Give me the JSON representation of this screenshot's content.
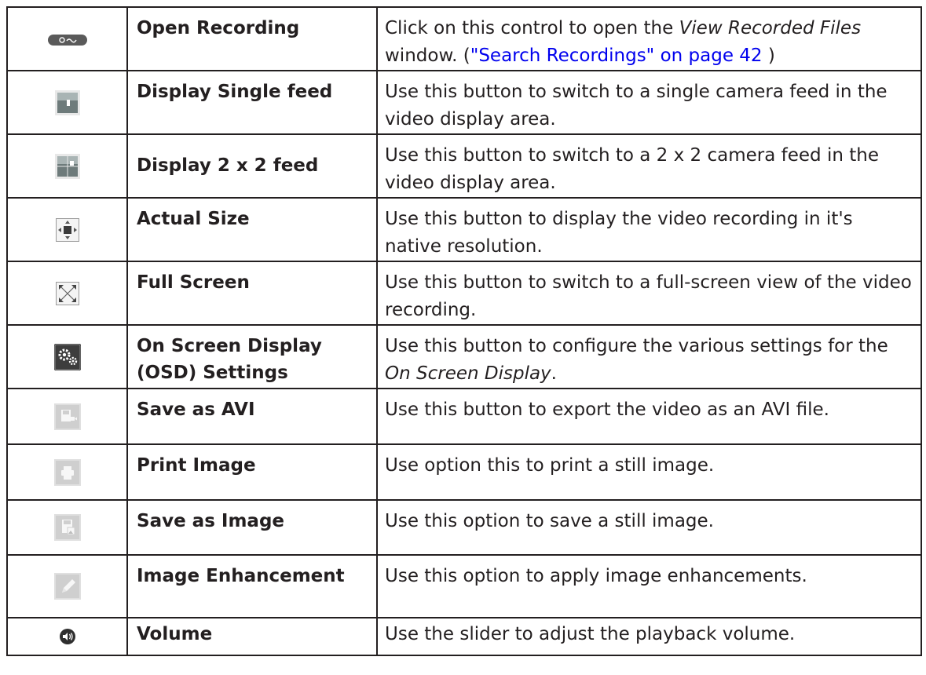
{
  "rows": [
    {
      "icon": "open-recording-icon",
      "name": "Open Recording",
      "desc_pre": "Click on this control to open the ",
      "desc_em": "View Recorded Files",
      "desc_mid": " window. (",
      "desc_link": "\"Search Recordings\" on page 42",
      "desc_post": " )"
    },
    {
      "icon": "single-feed-icon",
      "name": "Display Single feed",
      "desc": "Use this button to switch to a single camera feed in the video display area."
    },
    {
      "icon": "quad-feed-icon",
      "name": "Display 2 x 2 feed",
      "desc": "Use this button to switch to a 2 x 2 camera feed in the video display area."
    },
    {
      "icon": "actual-size-icon",
      "name": "Actual Size",
      "desc": "Use this button to display the video recording in it's native resolution."
    },
    {
      "icon": "full-screen-icon",
      "name": "Full Screen",
      "desc": "Use this button to switch to a full-screen view of the video recording."
    },
    {
      "icon": "osd-settings-icon",
      "name": "On Screen Display (OSD) Settings",
      "desc_pre": "Use this button to configure the various settings for the ",
      "desc_em": "On Screen Display",
      "desc_post": "."
    },
    {
      "icon": "save-avi-icon",
      "name": "Save as AVI",
      "desc": "Use this button to export the video as an AVI file."
    },
    {
      "icon": "print-icon",
      "name": "Print Image",
      "desc": "Use option this to print a still image."
    },
    {
      "icon": "save-image-icon",
      "name": "Save as Image",
      "desc": "Use this option to save a still image."
    },
    {
      "icon": "pencil-icon",
      "name": "Image Enhancement",
      "desc": "Use this option to apply image enhancements."
    },
    {
      "icon": "volume-icon",
      "name": "Volume",
      "desc": "Use the slider to adjust the playback volume."
    }
  ]
}
